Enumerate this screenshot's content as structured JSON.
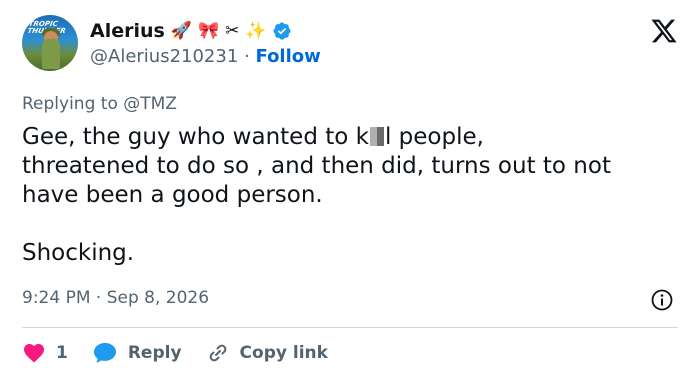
{
  "author": {
    "name": "Alerius",
    "emojis": [
      "🚀",
      "🎀",
      "✂",
      "✨"
    ],
    "handle": "@Alerius210231",
    "separator": "·",
    "follow_label": "Follow",
    "avatar_text": "TROPIC THUNDER"
  },
  "platform_icon": "x-logo-icon",
  "reply_context": {
    "prefix": "Replying to",
    "target": "@TMZ"
  },
  "tweet": {
    "line1_a": "Gee, the guy who wanted to k",
    "line1_b": "l people,",
    "line2": "threatened to do so , and then did, turns out to not",
    "line3": "have been a good person.",
    "line4": "Shocking."
  },
  "timestamp": "9:24 PM · Sep 8, 2026",
  "actions": {
    "like_count": "1",
    "reply_label": "Reply",
    "copy_label": "Copy link"
  },
  "colors": {
    "like": "#f91880",
    "reply": "#1d9bf0",
    "verified": "#1d9bf0",
    "follow": "#0069d9",
    "muted": "#536471"
  }
}
